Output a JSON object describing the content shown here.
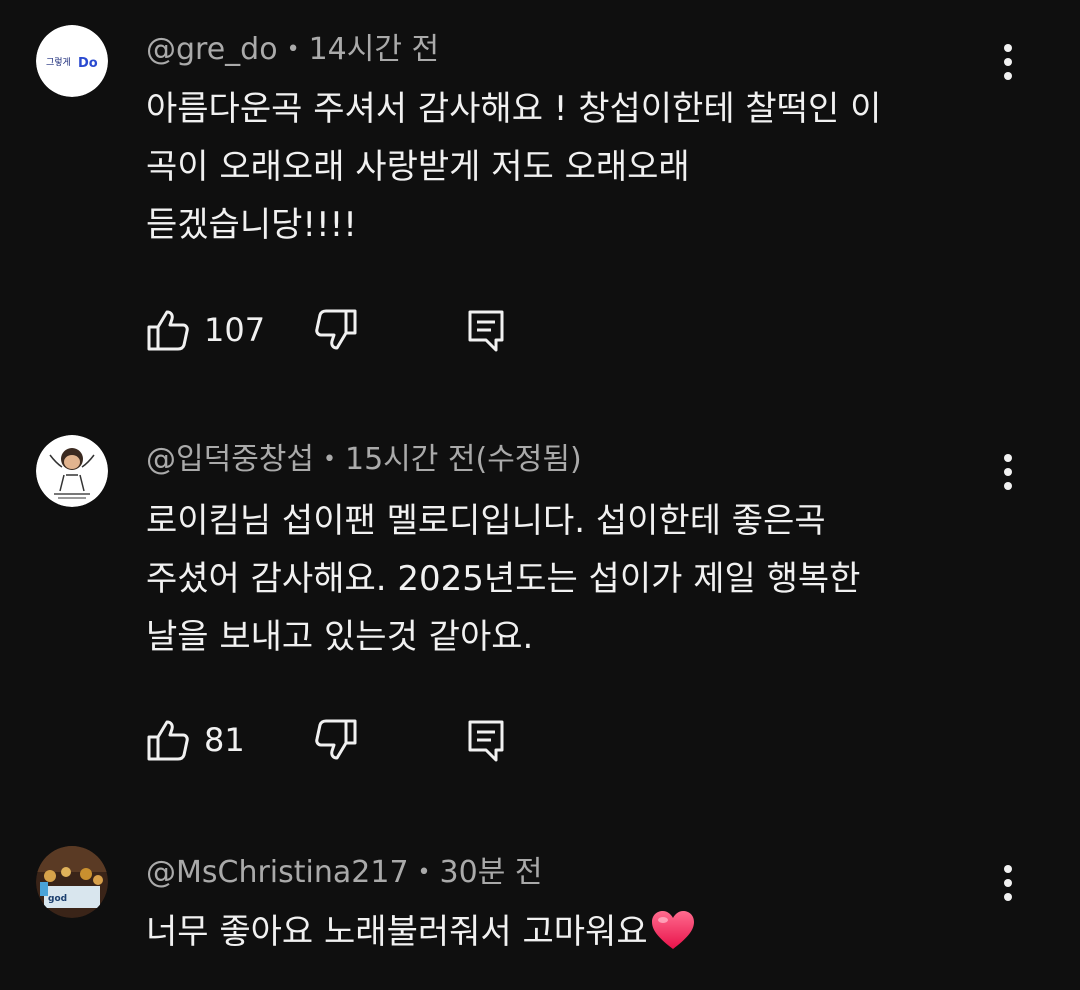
{
  "comments": [
    {
      "author": "@gre_do",
      "time": "14시간 전",
      "lines": [
        "아름다운곡 주셔서 감사해요 ! 창섭이한테 찰떡인 이",
        "곡이 오래오래 사랑받게 저도 오래오래",
        "듣겠습니당!!!!"
      ],
      "likes": "107",
      "avatar_text": "그렇게 Do"
    },
    {
      "author": "@입덕중창섭",
      "time": "15시간 전(수정됨)",
      "lines": [
        "로이킴님 섭이팬 멜로디입니다. 섭이한테 좋은곡",
        "주셨어 감사해요.  2025년도는 섭이가 제일 행복한",
        "날을 보내고 있는것 같아요."
      ],
      "likes": "81"
    },
    {
      "author": "@MsChristina217",
      "time": "30분 전",
      "lines": [
        "너무 좋아요 노래불러줘서 고마워요"
      ],
      "emoji": "❤️"
    }
  ],
  "icons": {
    "like": "thumbs-up-icon",
    "dislike": "thumbs-down-icon",
    "reply": "reply-icon",
    "more": "more-vert-icon"
  },
  "colors": {
    "background": "#0f0f0f",
    "primary_text": "#f1f1f1",
    "secondary_text": "#aaaaaa",
    "heart": "#ff3b6b"
  }
}
